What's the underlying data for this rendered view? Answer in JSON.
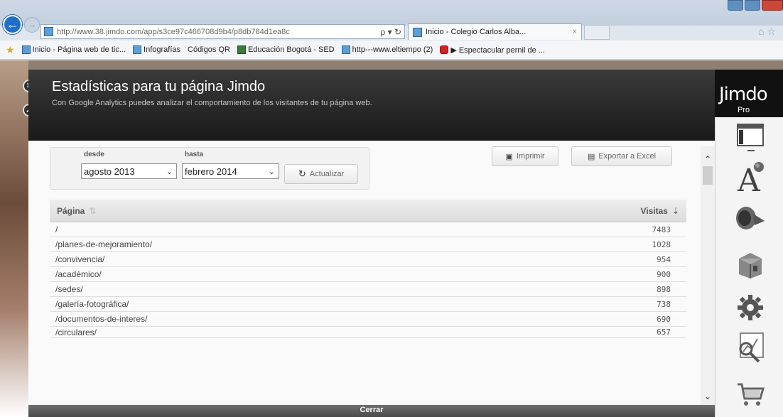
{
  "browser": {
    "address_url": "http://www.38.jimdo.com/app/s3ce97c466708d9b4/p8db784d1ea8c",
    "address_domain": "jimdo.com",
    "address_controls": "ρ ▾ ↻",
    "tab_title": "Inicio - Colegio Carlos Alba...",
    "tab_close": "×",
    "favorites": [
      "Inicio - Página web de tic...",
      "Infografías",
      "Códigos QR",
      "Educación Bogotá - SED",
      "http---www.eltiempo (2)",
      "▶ Espectacular pernil de ..."
    ]
  },
  "header": {
    "title": "Estadísticas para tu página Jimdo",
    "subtitle": "Con Google Analytics puedes analizar el comportamiento de los visitantes de tu página web."
  },
  "filters": {
    "from_label": "desde",
    "from_value": "agosto 2013",
    "to_label": "hasta",
    "to_value": "febrero 2014",
    "refresh_label": "Actualizar",
    "print_label": "Imprimir",
    "export_label": "Exportar a Excel"
  },
  "table": {
    "col_page": "Página",
    "col_visits": "Visitas",
    "rows": [
      {
        "page": "/",
        "visits": "7483"
      },
      {
        "page": "/planes-de-mejoramiento/",
        "visits": "1028"
      },
      {
        "page": "/convivencia/",
        "visits": "954"
      },
      {
        "page": "/académico/",
        "visits": "900"
      },
      {
        "page": "/sedes/",
        "visits": "898"
      },
      {
        "page": "/galería-fotográfica/",
        "visits": "738"
      },
      {
        "page": "/documentos-de-interes/",
        "visits": "690"
      },
      {
        "page": "/circulares/",
        "visits": "657"
      }
    ]
  },
  "footer": {
    "close_label": "Cerrar"
  },
  "sidebar": {
    "brand": "Jimdo",
    "plan": "Pro"
  }
}
